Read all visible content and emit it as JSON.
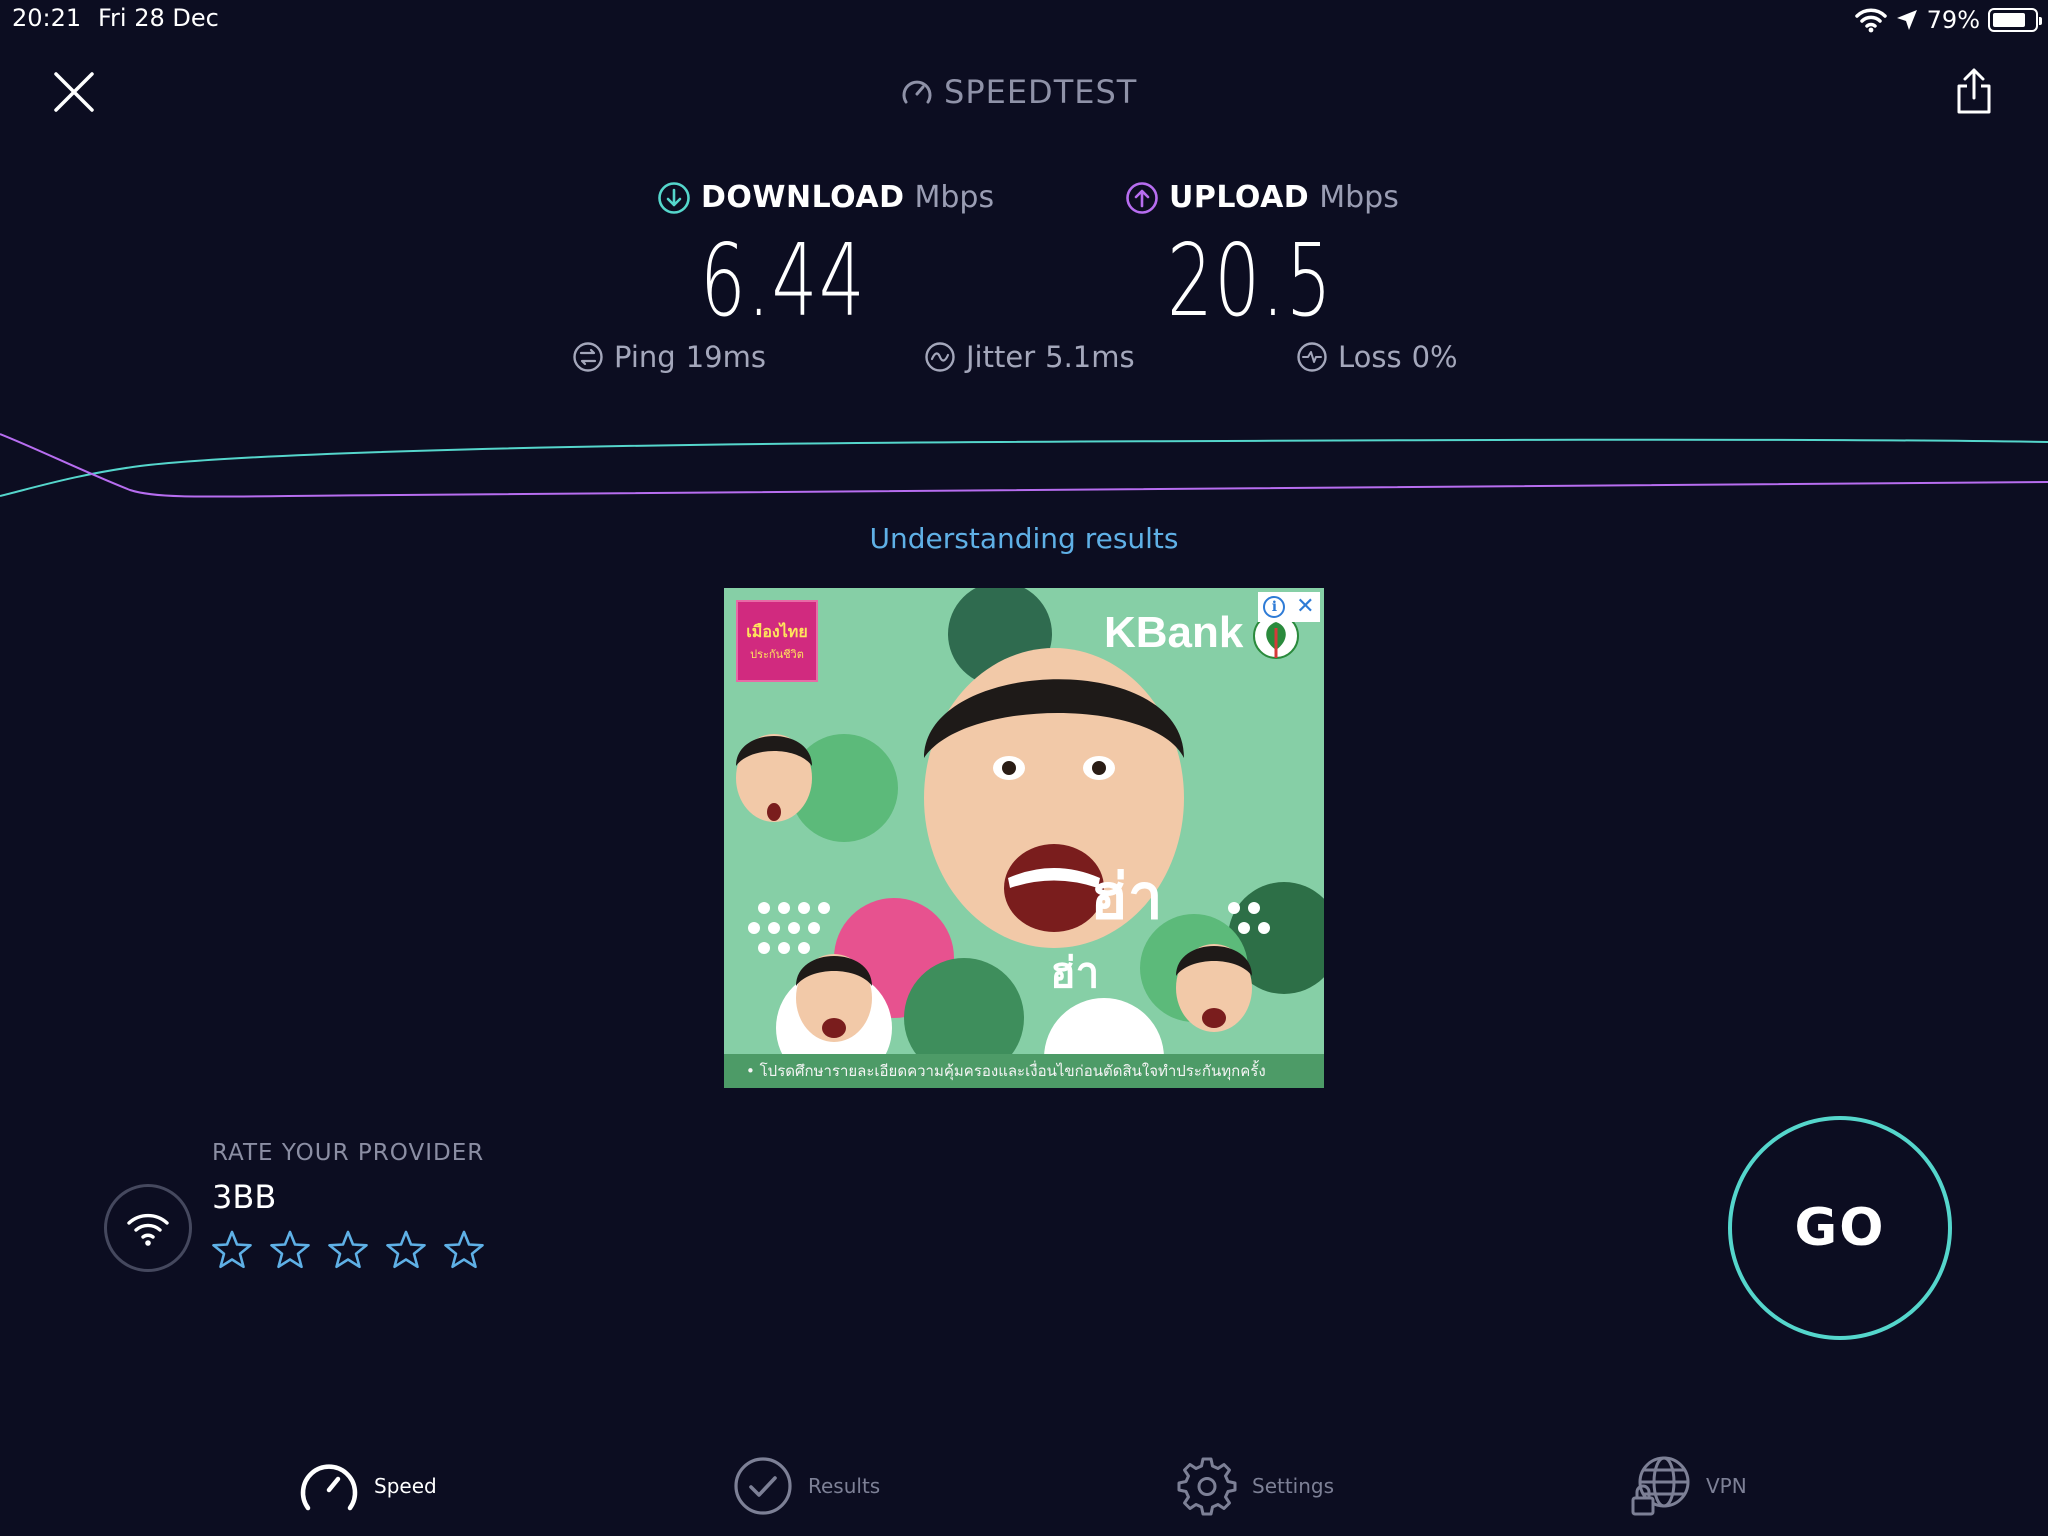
{
  "status_bar": {
    "time": "20:21",
    "date": "Fri 28 Dec",
    "battery": "79%",
    "battery_level": 0.79,
    "icons": [
      "wifi-icon",
      "location-arrow-icon",
      "battery-icon"
    ]
  },
  "header": {
    "brand": "SPEEDTEST",
    "close_icon": "close-icon",
    "share_icon": "share-icon"
  },
  "results": {
    "download": {
      "label": "DOWNLOAD",
      "unit": "Mbps",
      "value": "6.44"
    },
    "upload": {
      "label": "UPLOAD",
      "unit": "Mbps",
      "value": "20.5"
    },
    "ping": {
      "label": "Ping",
      "value": "19ms"
    },
    "jitter": {
      "label": "Jitter",
      "value": "5.1ms"
    },
    "loss": {
      "label": "Loss",
      "value": "0%"
    }
  },
  "understanding_link": "Understanding results",
  "ad": {
    "brand": "KBank",
    "corner_logo": "เมืองไทย",
    "corner_logo_sub": "ประกันชีวิต",
    "headline_1": "ฮ่า",
    "headline_2": "ฮ่า",
    "footer": "• โปรดศึกษารายละเอียดความคุ้มครองและเงื่อนไขก่อนตัดสินใจทำประกันทุกครั้ง"
  },
  "provider": {
    "heading": "RATE YOUR PROVIDER",
    "name": "3BB",
    "rating_max": 5,
    "rating": 0
  },
  "go_button": "GO",
  "tabs": [
    {
      "label": "Speed",
      "icon": "speedometer-icon",
      "active": true
    },
    {
      "label": "Results",
      "icon": "checkmark-circle-icon",
      "active": false
    },
    {
      "label": "Settings",
      "icon": "gear-icon",
      "active": false
    },
    {
      "label": "VPN",
      "icon": "globe-lock-icon",
      "active": false
    }
  ],
  "colors": {
    "background": "#0c0d21",
    "download_accent": "#55d6cc",
    "upload_accent": "#b76df0",
    "link": "#5fb0e6",
    "star": "#5fb0e6"
  }
}
